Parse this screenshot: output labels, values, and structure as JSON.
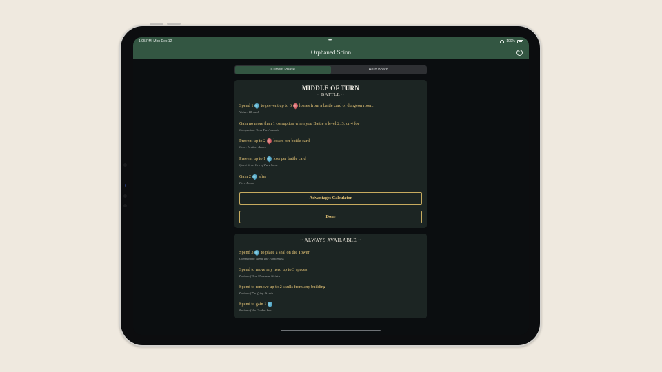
{
  "status": {
    "time": "1:05 PM",
    "date": "Mon Dec 12",
    "battery": "100%"
  },
  "header": {
    "title": "Orphaned Scion",
    "more_icon": "ellipsis-circle-icon"
  },
  "tabs": [
    {
      "label": "Current Phase",
      "active": true
    },
    {
      "label": "Hero Board",
      "active": false
    }
  ],
  "phase": {
    "title": "MIDDLE OF TURN",
    "subtitle": "~ BATTLE ~",
    "items": [
      {
        "pre": "Spend 1",
        "mid": "to prevent up to 6",
        "post": "losses from a battle card or dungeon room.",
        "source": "Virtue: Blessed"
      },
      {
        "text": "Gain no more than 1 corruption when you Battle a level 2, 3, or 4 foe",
        "source": "Companion: Yona The Assassin"
      },
      {
        "pre": "Prevent up to 2",
        "post": "losses per battle card",
        "source": "Gear: Leather Armor"
      },
      {
        "pre": "Prevent up to 1",
        "post": "loss per battle card",
        "source": "Quest Item: Orb of Pure Snow"
      },
      {
        "pre": "Gain 2",
        "post": "after",
        "source": "Hero Board"
      }
    ],
    "buttons": {
      "calculator": "Advantages Calculator",
      "done": "Done"
    }
  },
  "always": {
    "title": "~ ALWAYS AVAILABLE ~",
    "items": [
      {
        "pre": "Spend 3",
        "post": "to place a seal on the Tower",
        "source": "Companion: Nimit The Fathomless"
      },
      {
        "text": "Spend to move any hero up to 3 spaces",
        "source": "Potion of One Thousand Strides"
      },
      {
        "text": "Spend to remove up to 2 skulls from any building",
        "source": "Potion of Purifying Breath"
      },
      {
        "pre": "Spend to gain 1",
        "source": "Potion of the Golden Sun"
      }
    ]
  },
  "colors": {
    "accent_green": "#335642",
    "gold_text": "#e2c275",
    "card_bg": "#1c2523"
  }
}
